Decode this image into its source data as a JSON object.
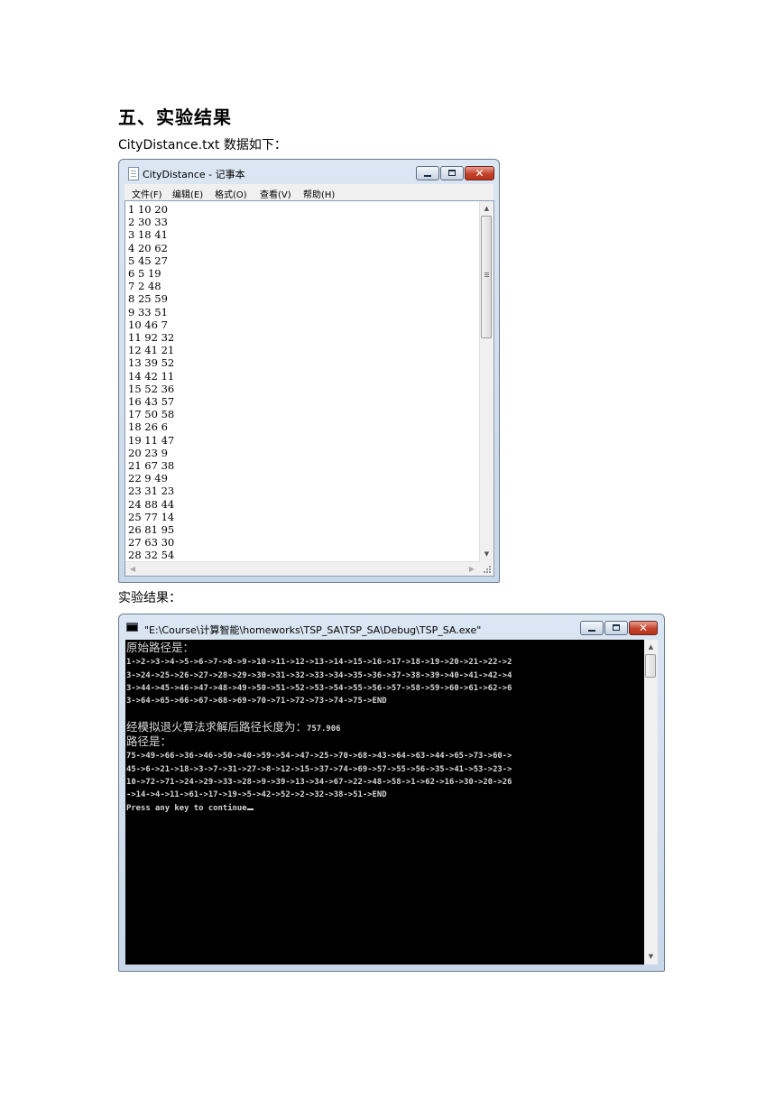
{
  "heading": "五、实验结果",
  "intro_text": "CityDistance.txt 数据如下：",
  "result_label": "实验结果：",
  "notepad": {
    "title": "CityDistance - 记事本",
    "menu": [
      "文件(F)",
      "编辑(E)",
      "格式(O)",
      "查看(V)",
      "帮助(H)"
    ],
    "content": "1 10 20\n2 30 33\n3 18 41\n4 20 62\n5 45 27\n6 5 19\n7 2 48\n8 25 59\n9 33 51\n10 46 7\n11 92 32\n12 41 21\n13 39 52\n14 42 11\n15 52 36\n16 43 57\n17 50 58\n18 26 6\n19 11 47\n20 23 9\n21 67 38\n22 9 49\n23 31 23\n24 88 44\n25 77 14\n26 81 95\n27 63 30\n28 32 54"
  },
  "console": {
    "title": "\"E:\\Course\\计算智能\\homeworks\\TSP_SA\\TSP_SA\\Debug\\TSP_SA.exe\"",
    "line_original_label": "原始路径是：",
    "original_path": "1->2->3->4->5->6->7->8->9->10->11->12->13->14->15->16->17->18->19->20->21->22->2\n3->24->25->26->27->28->29->30->31->32->33->34->35->36->37->38->39->40->41->42->4\n3->44->45->46->47->48->49->50->51->52->53->54->55->56->57->58->59->60->61->62->6\n3->64->65->66->67->68->69->70->71->72->73->74->75->END",
    "sa_length_label": "经模拟退火算法求解后路径长度为：",
    "sa_length_value": "757.906",
    "path_label": "路径是：",
    "result_path": "75->49->66->36->46->50->40->59->54->47->25->70->68->43->64->63->44->65->73->60->\n45->6->21->18->3->7->31->27->8->12->15->37->74->69->57->55->56->35->41->53->23->\n10->72->71->24->29->33->28->9->39->13->34->67->22->48->58->1->62->16->30->20->26\n->14->4->11->61->17->19->5->42->52->2->32->38->51->END",
    "prompt": "Press any key to continue"
  }
}
